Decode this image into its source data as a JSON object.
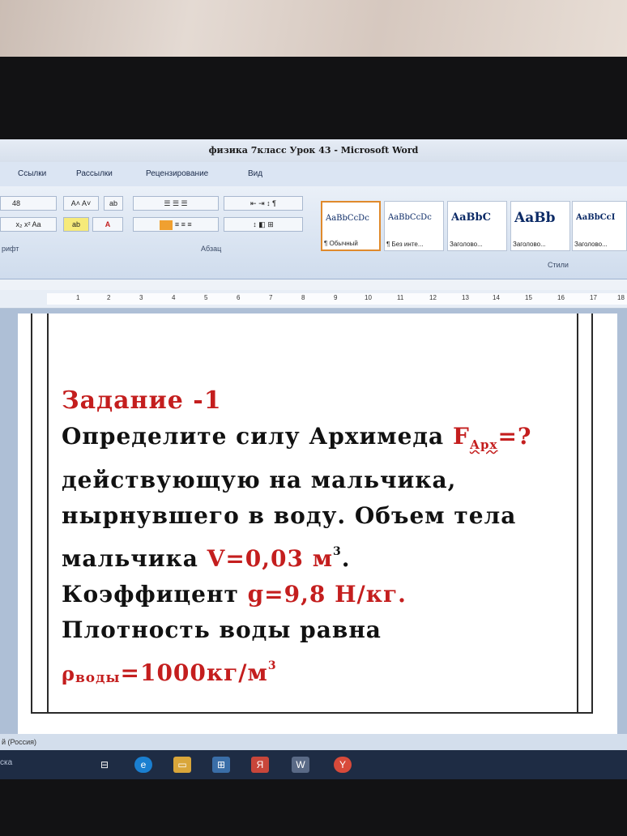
{
  "window": {
    "title": "физика 7класс Урок 43 - Microsoft Word"
  },
  "tabs": [
    "Ссылки",
    "Рассылки",
    "Рецензирование",
    "Вид"
  ],
  "ribbon": {
    "font_size": "48",
    "font_group_label": "рифт",
    "paragraph_group_label": "Абзац",
    "styles_group_label": "Стили",
    "styles": [
      {
        "sample": "AaBbCcDc",
        "name": "¶ Обычный"
      },
      {
        "sample": "AaBbCcDc",
        "name": "¶ Без инте..."
      },
      {
        "sample": "AaBbC",
        "name": "Заголово..."
      },
      {
        "sample": "AaBb",
        "name": "Заголово..."
      },
      {
        "sample": "AaBbCcI",
        "name": "Заголово..."
      }
    ]
  },
  "ruler": {
    "ticks": [
      "1",
      "2",
      "3",
      "4",
      "5",
      "6",
      "7",
      "8",
      "9",
      "10",
      "11",
      "12",
      "13",
      "14",
      "15",
      "16",
      "17",
      "18"
    ]
  },
  "document": {
    "title": "Задание -1",
    "line1": "Определите силу Архимеда",
    "force_symbol": "F",
    "force_sub": "Арх",
    "force_rest": "=?",
    "line2": "действующую на мальчика,",
    "line3": "нырнувшего в воду. Объем тела",
    "line4": "мальчика",
    "volume": "V=0,03 м",
    "volume_exp": "3",
    "period": ".",
    "line5": "Коэффицент",
    "g_value": "g=9,8 Н/кг.",
    "line6": "Плотность воды равна",
    "rho_symbol": "ρ",
    "rho_sub": "воды",
    "rho_value": "=1000кг/м",
    "rho_exp": "3"
  },
  "statusbar": {
    "language": "й (Россия)"
  },
  "taskbar": {
    "search": "ска"
  },
  "colors": {
    "accent_red": "#c41e1e",
    "ribbon_blue": "#dbe5f3",
    "taskbar": "#1e2c44"
  }
}
